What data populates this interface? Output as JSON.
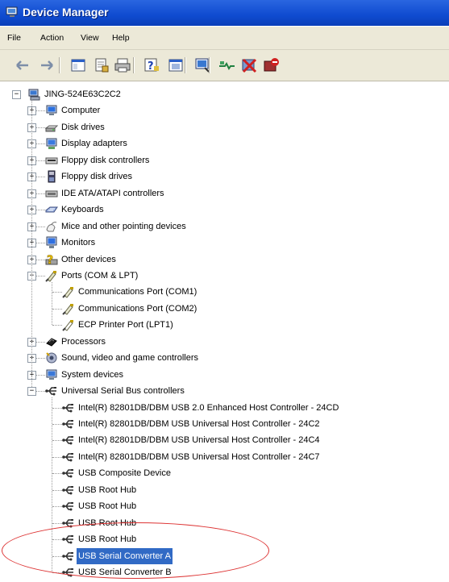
{
  "window": {
    "title": "Device Manager"
  },
  "menu": [
    "File",
    "Action",
    "View",
    "Help"
  ],
  "toolbar_icons": [
    "back-arrow-icon",
    "forward-arrow-icon",
    "show-hide-tree-icon",
    "properties-icon",
    "print-icon",
    "help-icon",
    "toggle-view-icon",
    "scan-hardware-icon",
    "update-driver-icon",
    "uninstall-icon",
    "disable-icon"
  ],
  "tree": {
    "root": "JING-524E63C2C2",
    "categories": [
      {
        "label": "Computer",
        "icon": "computer-icon",
        "expanded": false
      },
      {
        "label": "Disk drives",
        "icon": "disk-drive-icon",
        "expanded": false
      },
      {
        "label": "Display adapters",
        "icon": "display-adapter-icon",
        "expanded": false
      },
      {
        "label": "Floppy disk controllers",
        "icon": "floppy-controller-icon",
        "expanded": false
      },
      {
        "label": "Floppy disk drives",
        "icon": "floppy-drive-icon",
        "expanded": false
      },
      {
        "label": "IDE ATA/ATAPI controllers",
        "icon": "ide-controller-icon",
        "expanded": false
      },
      {
        "label": "Keyboards",
        "icon": "keyboard-icon",
        "expanded": false
      },
      {
        "label": "Mice and other pointing devices",
        "icon": "mouse-icon",
        "expanded": false
      },
      {
        "label": "Monitors",
        "icon": "monitor-icon",
        "expanded": false
      },
      {
        "label": "Other devices",
        "icon": "unknown-device-icon",
        "expanded": false
      },
      {
        "label": "Ports (COM & LPT)",
        "icon": "port-icon",
        "expanded": true,
        "children": [
          "Communications Port (COM1)",
          "Communications Port (COM2)",
          "ECP Printer Port (LPT1)"
        ]
      },
      {
        "label": "Processors",
        "icon": "processor-icon",
        "expanded": false
      },
      {
        "label": "Sound, video and game controllers",
        "icon": "sound-icon",
        "expanded": false
      },
      {
        "label": "System devices",
        "icon": "system-device-icon",
        "expanded": false
      },
      {
        "label": "Universal Serial Bus controllers",
        "icon": "usb-icon",
        "expanded": true,
        "children": [
          "Intel(R) 82801DB/DBM USB 2.0 Enhanced Host Controller - 24CD",
          "Intel(R) 82801DB/DBM USB Universal Host Controller - 24C2",
          "Intel(R) 82801DB/DBM USB Universal Host Controller - 24C4",
          "Intel(R) 82801DB/DBM USB Universal Host Controller - 24C7",
          "USB Composite Device",
          "USB Root Hub",
          "USB Root Hub",
          "USB Root Hub",
          "USB Root Hub",
          "USB Serial Converter A",
          "USB Serial Converter B"
        ]
      }
    ],
    "selected": "USB Serial Converter A"
  },
  "colors": {
    "title_bar": "#0f4bd0",
    "selection": "#316ac5",
    "annotation_ellipse": "#dd3333"
  }
}
